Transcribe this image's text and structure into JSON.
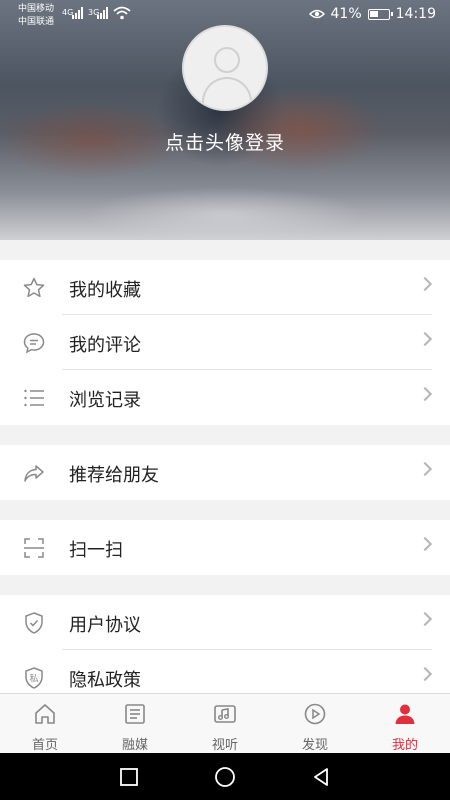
{
  "status_bar": {
    "carrier1": "中国移动",
    "carrier2": "中国联通",
    "net1": "4G",
    "net2": "3G",
    "battery_percent": "41%",
    "time": "14:19"
  },
  "header": {
    "login_text": "点击头像登录"
  },
  "menu_groups": [
    {
      "items": [
        {
          "label": "我的收藏",
          "icon": "star-icon"
        },
        {
          "label": "我的评论",
          "icon": "comment-icon"
        },
        {
          "label": "浏览记录",
          "icon": "list-icon"
        }
      ]
    },
    {
      "items": [
        {
          "label": "推荐给朋友",
          "icon": "share-icon"
        }
      ]
    },
    {
      "items": [
        {
          "label": "扫一扫",
          "icon": "scan-icon"
        }
      ]
    },
    {
      "items": [
        {
          "label": "用户协议",
          "icon": "shield-check-icon"
        },
        {
          "label": "隐私政策",
          "icon": "privacy-shield-icon",
          "badge": "私"
        }
      ]
    }
  ],
  "tabbar": {
    "tabs": [
      {
        "label": "首页",
        "icon": "home-icon"
      },
      {
        "label": "融媒",
        "icon": "news-icon"
      },
      {
        "label": "视听",
        "icon": "video-music-icon"
      },
      {
        "label": "发现",
        "icon": "discover-icon"
      },
      {
        "label": "我的",
        "icon": "person-icon",
        "active": true
      }
    ]
  },
  "colors": {
    "accent": "#e0303c",
    "background": "#f2f2f2"
  }
}
